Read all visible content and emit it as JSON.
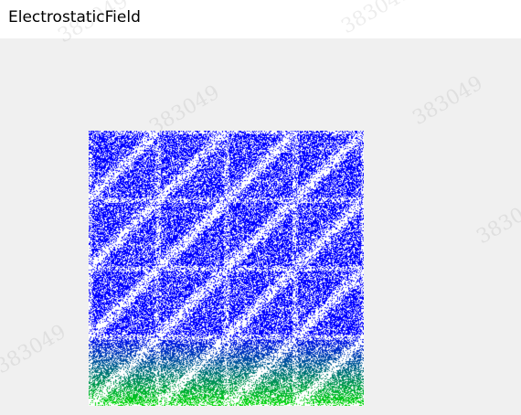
{
  "window": {
    "title": "ElectrostaticField"
  },
  "watermark": {
    "text": "383049"
  },
  "visualization": {
    "grid_cells": 4,
    "colors": {
      "top": "#0000ff",
      "bottom": "#00dd00",
      "background": "#ffffff",
      "window_bg": "#f0f0f0"
    }
  }
}
